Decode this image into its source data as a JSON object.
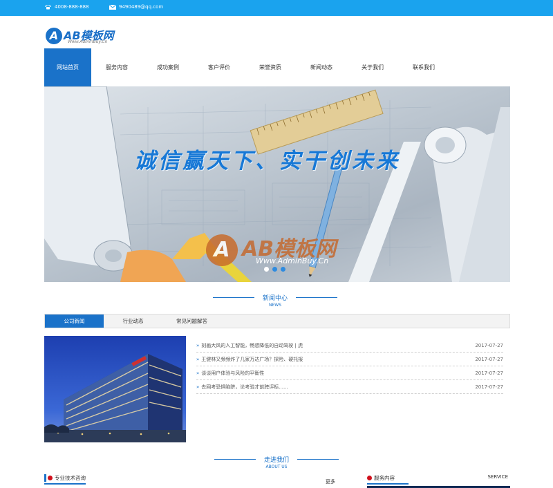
{
  "topbar": {
    "phone": "4008-888-888",
    "email": "9490489@qq.com"
  },
  "logo": {
    "letter": "A",
    "brand": "AB模板网",
    "site": "Www.AdminBuy.Cn"
  },
  "nav": {
    "items": [
      "网站首页",
      "服务内容",
      "成功案例",
      "客户评价",
      "荣誉资质",
      "新闻动态",
      "关于我们",
      "联系我们"
    ],
    "active": "网站首页"
  },
  "banner": {
    "slogan": "诚信赢天下、实干创未来",
    "watermark_letter": "A",
    "watermark_brand": "AB模板网",
    "watermark_site": "Www.AdminBuy.Cn",
    "active_slide": 1,
    "slide_count": 3
  },
  "news_section": {
    "title": "新闻中心",
    "subtitle": "NEWS",
    "tabs": [
      "公司新闻",
      "行业动态",
      "常见问题解答"
    ],
    "items": [
      {
        "title": "刻画大风的人工智能，畅想降低的自动驾驶 | 虎",
        "date": "2017-07-27"
      },
      {
        "title": "王健林又频频炸了几家万达广场？探险、硬托报",
        "date": "2017-07-27"
      },
      {
        "title": "谈谈用户体验与风险的平衡性",
        "date": "2017-07-27"
      },
      {
        "title": "去网考恐惧陷阱，论考验才前跨评标......",
        "date": "2017-07-27"
      }
    ]
  },
  "about_section": {
    "title": "走进我们",
    "subtitle": "ABOUT US"
  },
  "bottom": {
    "left_title": "专业技术咨询",
    "more": "更多",
    "right_title": "服务内容",
    "right_tag": "SERVICE"
  },
  "colors": {
    "topbar": "#1aa3ee",
    "primary": "#1a72c9",
    "accent_red": "#d0101c"
  }
}
